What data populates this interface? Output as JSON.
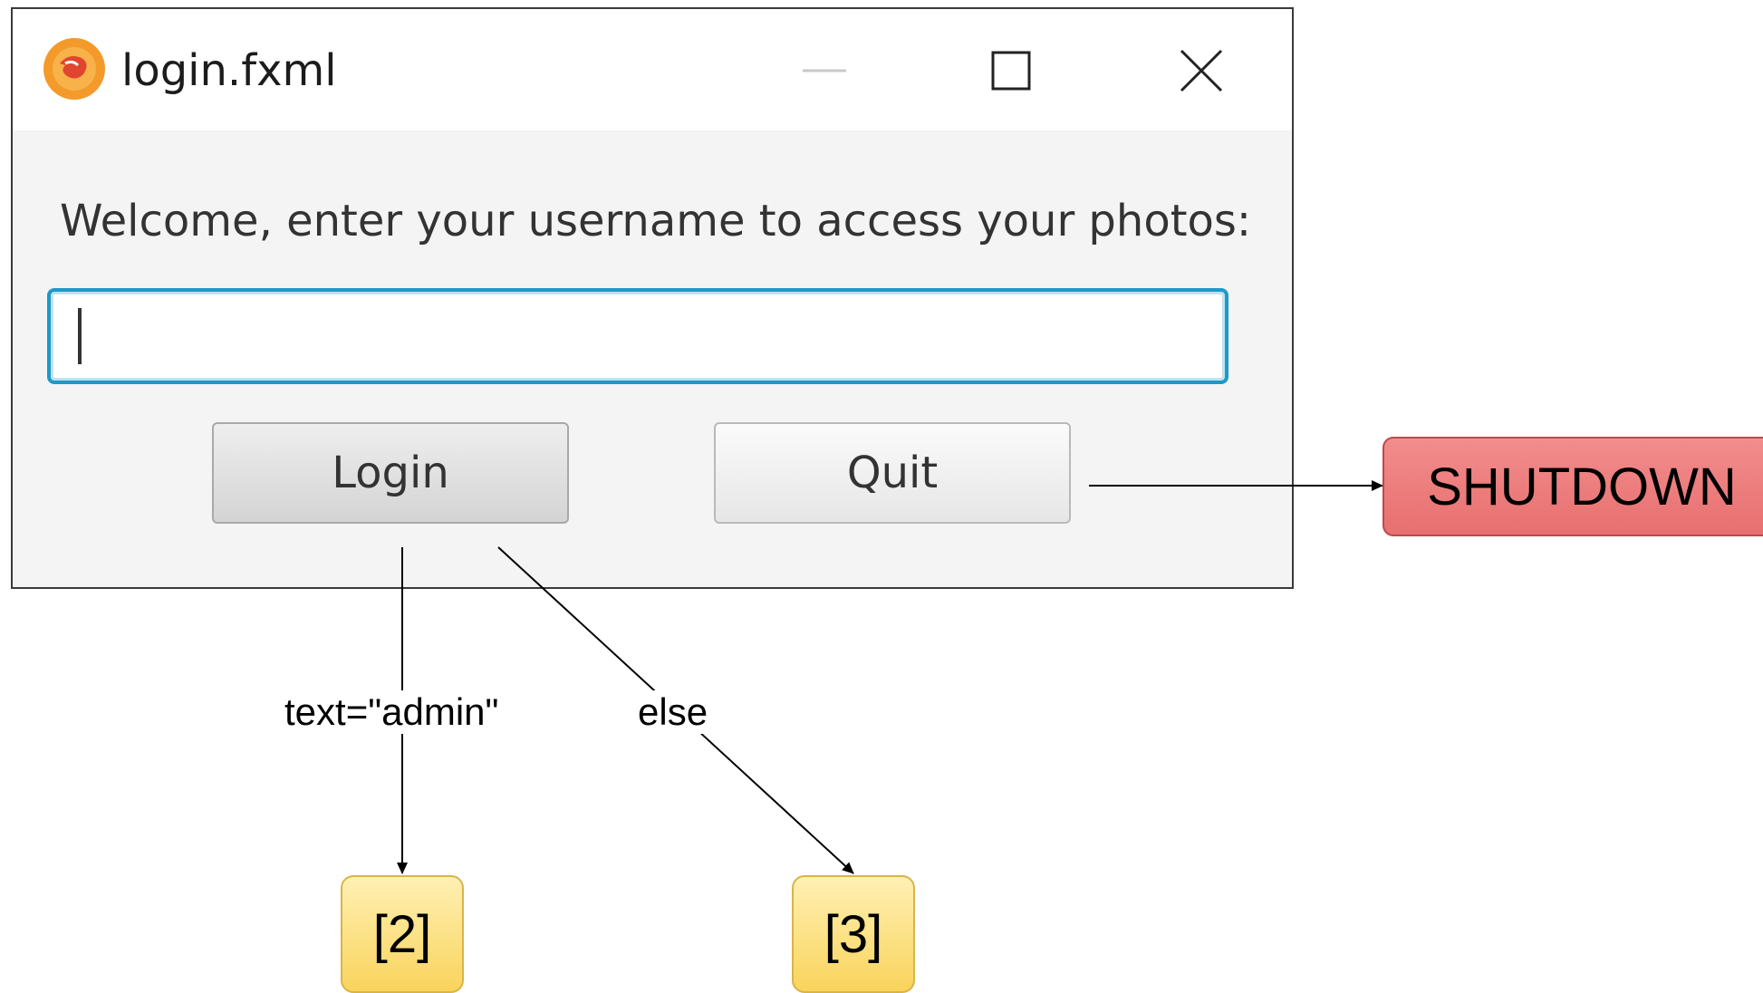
{
  "window": {
    "title": "login.fxml",
    "icon": "app-logo-icon",
    "controls": [
      "minimize-icon",
      "maximize-icon",
      "close-icon"
    ]
  },
  "form": {
    "prompt": "Welcome, enter your username to access your photos:",
    "username_value": "",
    "login_label": "Login",
    "quit_label": "Quit"
  },
  "diagram": {
    "nodes": {
      "shutdown": "SHUTDOWN",
      "state_2": "[2]",
      "state_3": "[3]"
    },
    "edges": {
      "login_admin": "text=\"admin\"",
      "login_else": "else"
    }
  },
  "colors": {
    "input_focus": "#1d99c9",
    "shutdown_node": "#e86f6f",
    "state_node": "#f9d45c",
    "app_icon": "#f39a2b"
  }
}
